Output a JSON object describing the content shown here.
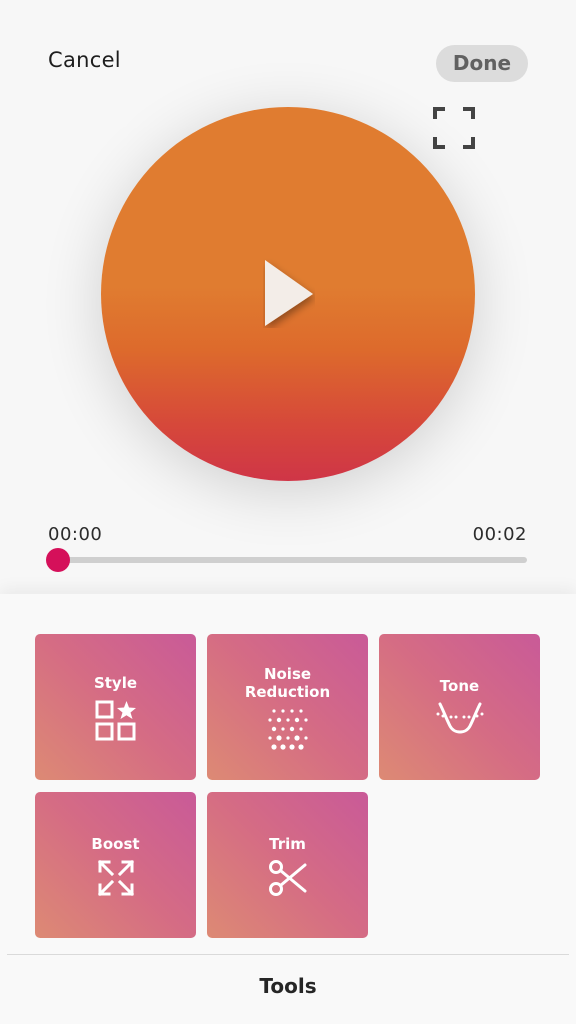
{
  "header": {
    "cancel_label": "Cancel",
    "done_label": "Done"
  },
  "player": {
    "time_current": "00:00",
    "time_total": "00:02",
    "progress": 0,
    "accent": "#d5105a",
    "artwork_colors": [
      "#e07c30",
      "#cf3547"
    ]
  },
  "tools": [
    {
      "label": "Style",
      "icon": "style-grid-star-icon"
    },
    {
      "label": "Noise\nReduction",
      "icon": "noise-dots-icon"
    },
    {
      "label": "Tone",
      "icon": "tone-curve-icon"
    },
    {
      "label": "Boost",
      "icon": "boost-arrows-icon"
    },
    {
      "label": "Trim",
      "icon": "scissors-icon"
    }
  ],
  "bottom_bar": {
    "active_tab": "Tools"
  }
}
